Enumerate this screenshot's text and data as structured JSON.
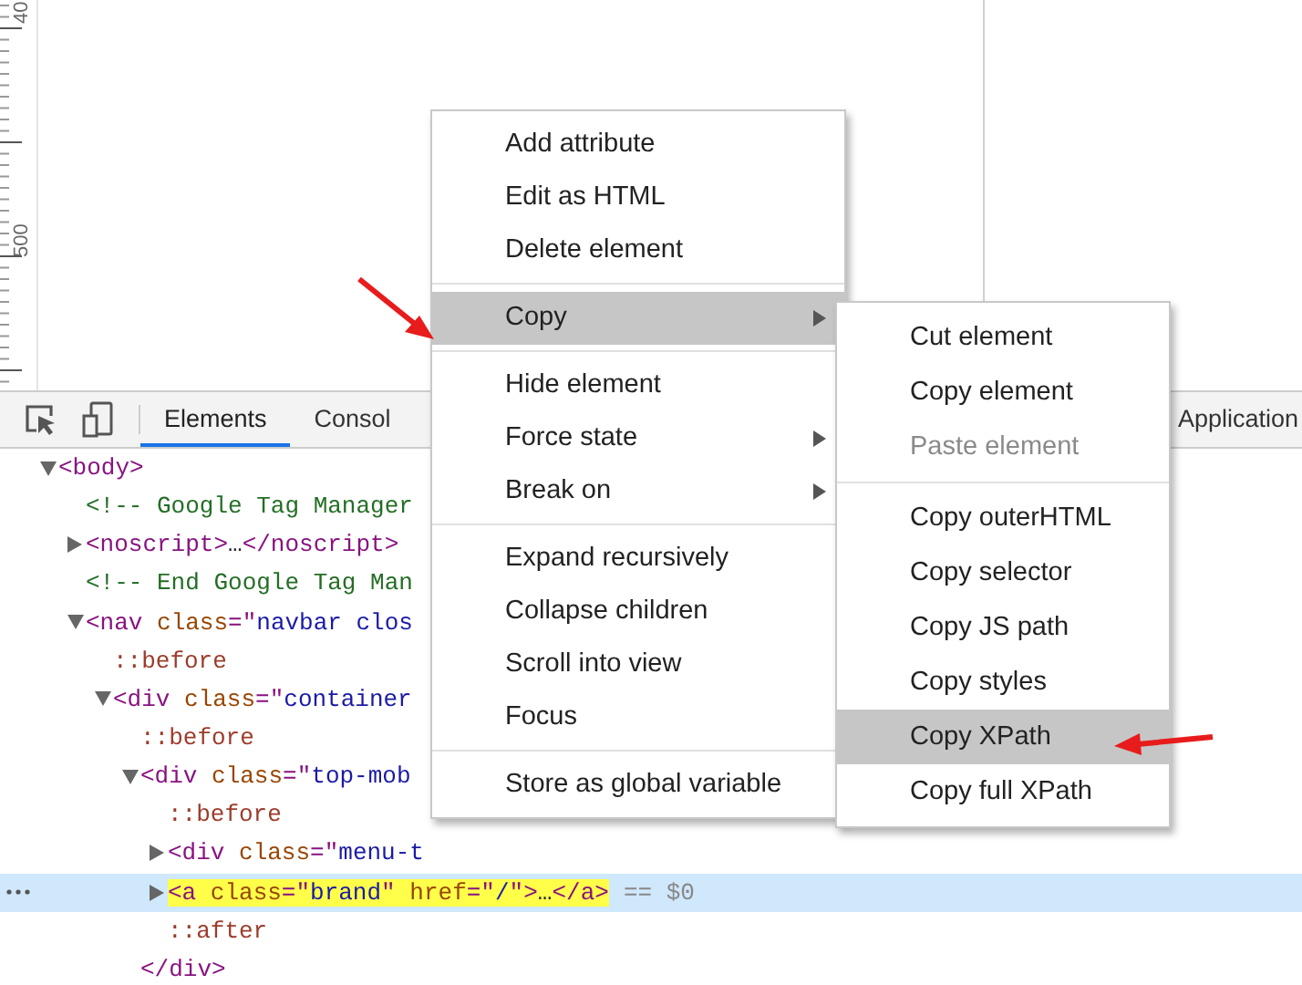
{
  "ruler": {
    "labels": [
      "40",
      "500"
    ]
  },
  "toolbar": {
    "tabs": [
      {
        "label": "Elements",
        "selected": true
      },
      {
        "label": "Consol",
        "selected": false
      },
      {
        "label": "Application",
        "selected": false
      }
    ]
  },
  "dom_tree": [
    {
      "tokens": [
        {
          "kind": "tag",
          "text": "<body>"
        }
      ],
      "expanded": true,
      "selected": false,
      "highlighted": false,
      "children": [
        {
          "tokens": [
            {
              "kind": "comment",
              "text": "<!-- Google Tag Manager"
            }
          ],
          "selected": false,
          "highlighted": false
        },
        {
          "tokens": [
            {
              "kind": "tag",
              "text": "<noscript>"
            },
            {
              "kind": "plain",
              "text": "…"
            },
            {
              "kind": "tag",
              "text": "</noscript>"
            }
          ],
          "expanded": false,
          "selected": false,
          "highlighted": false
        },
        {
          "tokens": [
            {
              "kind": "comment",
              "text": "<!-- End Google Tag Man"
            }
          ],
          "selected": false,
          "highlighted": false
        },
        {
          "tokens": [
            {
              "kind": "tag",
              "text": "<nav"
            },
            {
              "kind": "attr",
              "text": " class"
            },
            {
              "kind": "tag",
              "text": "=\""
            },
            {
              "kind": "value",
              "text": "navbar clos"
            }
          ],
          "expanded": true,
          "selected": false,
          "highlighted": false,
          "children": [
            {
              "tokens": [
                {
                  "kind": "pseudo",
                  "text": "::before"
                }
              ],
              "selected": false,
              "highlighted": false
            },
            {
              "tokens": [
                {
                  "kind": "tag",
                  "text": "<div"
                },
                {
                  "kind": "attr",
                  "text": " class"
                },
                {
                  "kind": "tag",
                  "text": "=\""
                },
                {
                  "kind": "value",
                  "text": "container"
                }
              ],
              "expanded": true,
              "selected": false,
              "highlighted": false,
              "children": [
                {
                  "tokens": [
                    {
                      "kind": "pseudo",
                      "text": "::before"
                    }
                  ],
                  "selected": false,
                  "highlighted": false
                },
                {
                  "tokens": [
                    {
                      "kind": "tag",
                      "text": "<div"
                    },
                    {
                      "kind": "attr",
                      "text": " class"
                    },
                    {
                      "kind": "tag",
                      "text": "=\""
                    },
                    {
                      "kind": "value",
                      "text": "top-mob"
                    }
                  ],
                  "expanded": true,
                  "selected": false,
                  "highlighted": false,
                  "closing": [
                    {
                      "kind": "tag",
                      "text": "</div>"
                    }
                  ],
                  "children": [
                    {
                      "tokens": [
                        {
                          "kind": "pseudo",
                          "text": "::before"
                        }
                      ],
                      "selected": false,
                      "highlighted": false
                    },
                    {
                      "tokens": [
                        {
                          "kind": "tag",
                          "text": "<div"
                        },
                        {
                          "kind": "attr",
                          "text": " class"
                        },
                        {
                          "kind": "tag",
                          "text": "=\""
                        },
                        {
                          "kind": "value",
                          "text": "menu-t"
                        }
                      ],
                      "expanded": false,
                      "selected": false,
                      "highlighted": false
                    },
                    {
                      "tokens": [
                        {
                          "kind": "tag",
                          "text": "<a"
                        },
                        {
                          "kind": "attr",
                          "text": " class"
                        },
                        {
                          "kind": "tag",
                          "text": "=\""
                        },
                        {
                          "kind": "value",
                          "text": "brand"
                        },
                        {
                          "kind": "tag",
                          "text": "\""
                        },
                        {
                          "kind": "attr",
                          "text": " href"
                        },
                        {
                          "kind": "tag",
                          "text": "=\""
                        },
                        {
                          "kind": "value",
                          "text": "/"
                        },
                        {
                          "kind": "tag",
                          "text": "\">"
                        },
                        {
                          "kind": "plain",
                          "text": "…"
                        },
                        {
                          "kind": "tag",
                          "text": "</a>"
                        }
                      ],
                      "suffix": "== $0",
                      "expanded": false,
                      "selected": true,
                      "highlighted": true
                    },
                    {
                      "tokens": [
                        {
                          "kind": "pseudo",
                          "text": "::after"
                        }
                      ],
                      "selected": false,
                      "highlighted": false
                    }
                  ]
                }
              ]
            }
          ]
        }
      ]
    }
  ],
  "context_menu": {
    "groups": [
      [
        {
          "label": "Add attribute",
          "selected": false,
          "disabled": false,
          "submenu": false
        },
        {
          "label": "Edit as HTML",
          "selected": false,
          "disabled": false,
          "submenu": false
        },
        {
          "label": "Delete element",
          "selected": false,
          "disabled": false,
          "submenu": false
        }
      ],
      [
        {
          "label": "Copy",
          "selected": true,
          "disabled": false,
          "submenu": true
        }
      ],
      [
        {
          "label": "Hide element",
          "selected": false,
          "disabled": false,
          "submenu": false
        },
        {
          "label": "Force state",
          "selected": false,
          "disabled": false,
          "submenu": true
        },
        {
          "label": "Break on",
          "selected": false,
          "disabled": false,
          "submenu": true
        }
      ],
      [
        {
          "label": "Expand recursively",
          "selected": false,
          "disabled": false,
          "submenu": false
        },
        {
          "label": "Collapse children",
          "selected": false,
          "disabled": false,
          "submenu": false
        },
        {
          "label": "Scroll into view",
          "selected": false,
          "disabled": false,
          "submenu": false
        },
        {
          "label": "Focus",
          "selected": false,
          "disabled": false,
          "submenu": false
        }
      ],
      [
        {
          "label": "Store as global variable",
          "selected": false,
          "disabled": false,
          "submenu": false
        }
      ]
    ]
  },
  "copy_submenu": {
    "groups": [
      [
        {
          "label": "Cut element",
          "selected": false,
          "disabled": false,
          "submenu": false
        },
        {
          "label": "Copy element",
          "selected": false,
          "disabled": false,
          "submenu": false
        },
        {
          "label": "Paste element",
          "selected": false,
          "disabled": true,
          "submenu": false
        }
      ],
      [
        {
          "label": "Copy outerHTML",
          "selected": false,
          "disabled": false,
          "submenu": false
        },
        {
          "label": "Copy selector",
          "selected": false,
          "disabled": false,
          "submenu": false
        },
        {
          "label": "Copy JS path",
          "selected": false,
          "disabled": false,
          "submenu": false
        },
        {
          "label": "Copy styles",
          "selected": false,
          "disabled": false,
          "submenu": false
        },
        {
          "label": "Copy XPath",
          "selected": true,
          "disabled": false,
          "submenu": false
        },
        {
          "label": "Copy full XPath",
          "selected": false,
          "disabled": false,
          "submenu": false
        }
      ]
    ]
  }
}
